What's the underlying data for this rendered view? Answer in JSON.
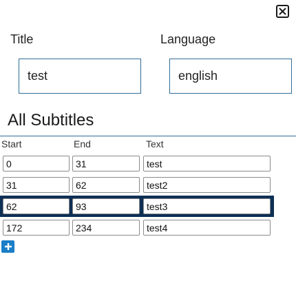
{
  "dialog": {
    "title_label": "Title",
    "language_label": "Language",
    "title_value": "test",
    "language_value": "english"
  },
  "subtitles": {
    "heading": "All Subtitles",
    "columns": {
      "start": "Start",
      "end": "End",
      "text": "Text"
    },
    "rows": [
      {
        "start": "0",
        "end": "31",
        "text": "test",
        "selected": false
      },
      {
        "start": "31",
        "end": "62",
        "text": "test2",
        "selected": false
      },
      {
        "start": "62",
        "end": "93",
        "text": "test3",
        "selected": true
      },
      {
        "start": "172",
        "end": "234",
        "text": "test4",
        "selected": false
      }
    ]
  },
  "icons": {
    "close": "close-icon",
    "add": "plus-icon"
  },
  "colors": {
    "accent": "#2f6b96",
    "selected_row": "#0d2f55",
    "add_button": "#1a7ec8"
  }
}
